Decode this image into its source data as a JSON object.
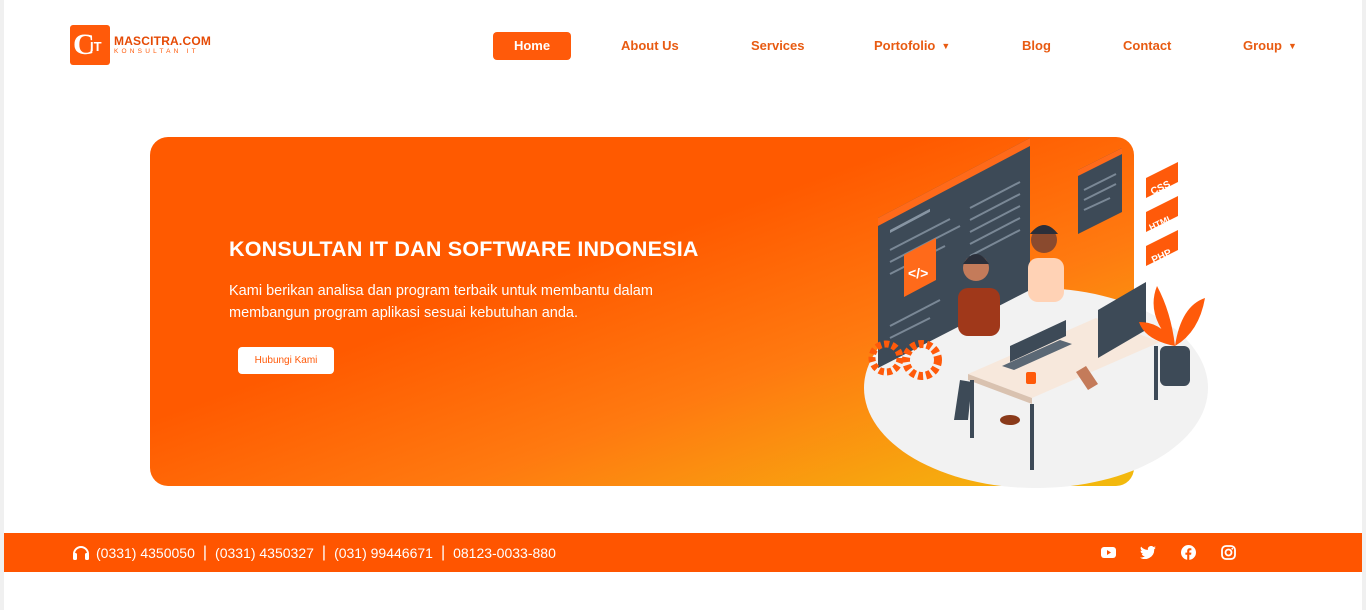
{
  "brand": {
    "logo_letters": "C",
    "logo_it": "IT",
    "name": "MASCITRA.COM",
    "tagline": "KONSULTAN IT",
    "accent_color": "#ff5a0a"
  },
  "nav": {
    "items": [
      {
        "label": "Home",
        "active": true
      },
      {
        "label": "About Us"
      },
      {
        "label": "Services"
      },
      {
        "label": "Portofolio",
        "dropdown": true
      },
      {
        "label": "Blog"
      },
      {
        "label": "Contact"
      },
      {
        "label": "Group",
        "dropdown": true
      }
    ],
    "caret": "▼"
  },
  "hero": {
    "title": "KONSULTAN IT DAN SOFTWARE INDONESIA",
    "description": "Kami berikan analisa dan program terbaik untuk membantu dalam membangun program aplikasi sesuai kebutuhan anda.",
    "button_label": "Hubungi Kami",
    "illustration_tags": [
      "CSS",
      "HTML",
      "PHP"
    ],
    "code_symbol": "</>"
  },
  "contact_bar": {
    "phones": [
      "(0331) 4350050",
      "(0331) 4350327",
      "(031) 99446671",
      "08123-0033-880"
    ],
    "separator": "|",
    "social_icons": [
      "youtube-icon",
      "twitter-icon",
      "facebook-icon",
      "instagram-icon"
    ]
  }
}
